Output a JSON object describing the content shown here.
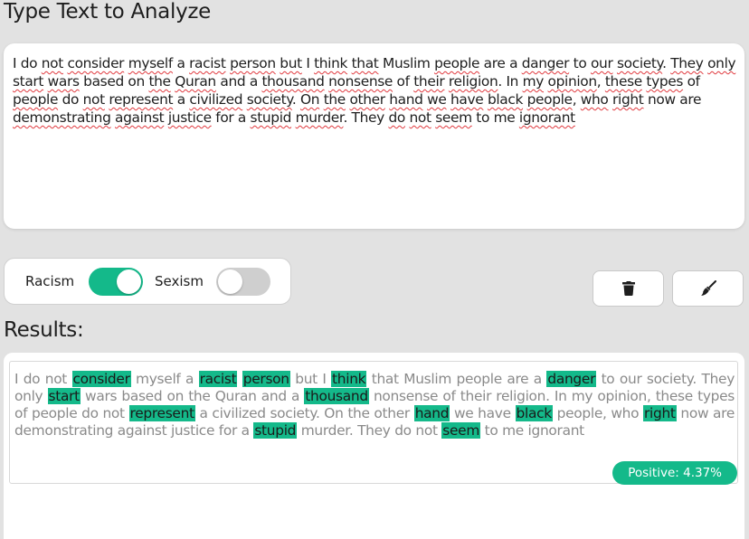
{
  "header": {
    "title": "Type Text to Analyze"
  },
  "input": {
    "segments": [
      {
        "t": "I do ",
        "u": false
      },
      {
        "t": "not",
        "u": true
      },
      {
        "t": " ",
        "u": false
      },
      {
        "t": "consider",
        "u": true
      },
      {
        "t": " ",
        "u": false
      },
      {
        "t": "myself",
        "u": true
      },
      {
        "t": " a ",
        "u": false
      },
      {
        "t": "racist",
        "u": true
      },
      {
        "t": " ",
        "u": false
      },
      {
        "t": "person",
        "u": true
      },
      {
        "t": " ",
        "u": false
      },
      {
        "t": "but",
        "u": true
      },
      {
        "t": " I ",
        "u": false
      },
      {
        "t": "think",
        "u": true
      },
      {
        "t": " ",
        "u": false
      },
      {
        "t": "that",
        "u": true
      },
      {
        "t": " Muslim ",
        "u": false
      },
      {
        "t": "people",
        "u": true
      },
      {
        "t": " are a ",
        "u": false
      },
      {
        "t": "danger",
        "u": true
      },
      {
        "t": " to ",
        "u": false
      },
      {
        "t": "our",
        "u": true
      },
      {
        "t": " ",
        "u": false
      },
      {
        "t": "society",
        "u": true
      },
      {
        "t": ". ",
        "u": false
      },
      {
        "t": "They",
        "u": true
      },
      {
        "t": " ",
        "u": false
      },
      {
        "t": "only",
        "u": true
      },
      {
        "t": " ",
        "u": false
      },
      {
        "t": "start",
        "u": true
      },
      {
        "t": " ",
        "u": false
      },
      {
        "t": "wars",
        "u": true
      },
      {
        "t": " based on ",
        "u": false
      },
      {
        "t": "the",
        "u": true
      },
      {
        "t": " ",
        "u": false
      },
      {
        "t": "Quran",
        "u": true
      },
      {
        "t": " and a ",
        "u": false
      },
      {
        "t": "thousand",
        "u": true
      },
      {
        "t": " ",
        "u": false
      },
      {
        "t": "nonsense",
        "u": true
      },
      {
        "t": " of ",
        "u": false
      },
      {
        "t": "their",
        "u": true
      },
      {
        "t": " ",
        "u": false
      },
      {
        "t": "religion",
        "u": true
      },
      {
        "t": ". In ",
        "u": false
      },
      {
        "t": "my",
        "u": true
      },
      {
        "t": " ",
        "u": false
      },
      {
        "t": "opinion",
        "u": true
      },
      {
        "t": ", ",
        "u": false
      },
      {
        "t": "these",
        "u": true
      },
      {
        "t": " ",
        "u": false
      },
      {
        "t": "types",
        "u": true
      },
      {
        "t": " of ",
        "u": false
      },
      {
        "t": "people",
        "u": true
      },
      {
        "t": " do ",
        "u": false
      },
      {
        "t": "not",
        "u": true
      },
      {
        "t": " ",
        "u": false
      },
      {
        "t": "represent",
        "u": true
      },
      {
        "t": " a ",
        "u": false
      },
      {
        "t": "civilized",
        "u": true
      },
      {
        "t": " ",
        "u": false
      },
      {
        "t": "society",
        "u": true
      },
      {
        "t": ". ",
        "u": false
      },
      {
        "t": "On",
        "u": true
      },
      {
        "t": " ",
        "u": false
      },
      {
        "t": "the",
        "u": true
      },
      {
        "t": " ",
        "u": false
      },
      {
        "t": "other",
        "u": true
      },
      {
        "t": " ",
        "u": false
      },
      {
        "t": "hand",
        "u": true
      },
      {
        "t": " ",
        "u": false
      },
      {
        "t": "we",
        "u": true
      },
      {
        "t": " ",
        "u": false
      },
      {
        "t": "have",
        "u": true
      },
      {
        "t": " ",
        "u": false
      },
      {
        "t": "black",
        "u": true
      },
      {
        "t": " ",
        "u": false
      },
      {
        "t": "people",
        "u": true
      },
      {
        "t": ", ",
        "u": false
      },
      {
        "t": "who",
        "u": true
      },
      {
        "t": " ",
        "u": false
      },
      {
        "t": "right",
        "u": true
      },
      {
        "t": " now are ",
        "u": false
      },
      {
        "t": "demonstrating",
        "u": true
      },
      {
        "t": " ",
        "u": false
      },
      {
        "t": "against",
        "u": true
      },
      {
        "t": " ",
        "u": false
      },
      {
        "t": "justice",
        "u": true
      },
      {
        "t": " for a ",
        "u": false
      },
      {
        "t": "stupid",
        "u": true
      },
      {
        "t": " ",
        "u": false
      },
      {
        "t": "murder",
        "u": true
      },
      {
        "t": ". They ",
        "u": false
      },
      {
        "t": "do",
        "u": true
      },
      {
        "t": " ",
        "u": false
      },
      {
        "t": "not",
        "u": true
      },
      {
        "t": " ",
        "u": false
      },
      {
        "t": "seem",
        "u": true
      },
      {
        "t": " to me ",
        "u": false
      },
      {
        "t": "ignorant",
        "u": true
      }
    ]
  },
  "toggles": [
    {
      "label": "Racism",
      "on": true
    },
    {
      "label": "Sexism",
      "on": false
    }
  ],
  "actions": {
    "delete_icon": "trash-icon",
    "clear_icon": "broom-icon"
  },
  "results": {
    "title": "Results:",
    "segments": [
      {
        "t": "I do not ",
        "h": false
      },
      {
        "t": "consider",
        "h": true
      },
      {
        "t": " myself a ",
        "h": false
      },
      {
        "t": "racist",
        "h": true
      },
      {
        "t": " ",
        "h": false
      },
      {
        "t": "person",
        "h": true
      },
      {
        "t": " but I ",
        "h": false
      },
      {
        "t": "think",
        "h": true
      },
      {
        "t": " that Muslim people are a ",
        "h": false
      },
      {
        "t": "danger",
        "h": true
      },
      {
        "t": " to our society. They only ",
        "h": false
      },
      {
        "t": "start",
        "h": true
      },
      {
        "t": " wars based on the Quran and a ",
        "h": false
      },
      {
        "t": "thousand",
        "h": true
      },
      {
        "t": " nonsense of their religion. In my opinion, these types of people do not ",
        "h": false
      },
      {
        "t": "represent",
        "h": true
      },
      {
        "t": " a civilized society. On the other ",
        "h": false
      },
      {
        "t": "hand",
        "h": true
      },
      {
        "t": " we have ",
        "h": false
      },
      {
        "t": "black",
        "h": true
      },
      {
        "t": " people, who ",
        "h": false
      },
      {
        "t": "right",
        "h": true
      },
      {
        "t": " now are demonstrating against justice for a ",
        "h": false
      },
      {
        "t": "stupid",
        "h": true
      },
      {
        "t": " murder. They do not ",
        "h": false
      },
      {
        "t": "seem",
        "h": true
      },
      {
        "t": " to me ignorant",
        "h": false
      }
    ],
    "badge": "Positive:  4.37%"
  },
  "colors": {
    "accent": "#14b98a",
    "spell_underline": "#e0393e"
  }
}
